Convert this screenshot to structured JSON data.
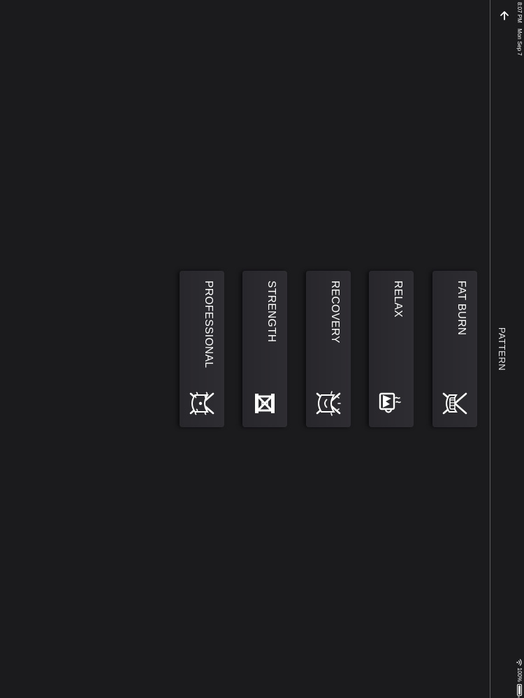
{
  "status_bar": {
    "time": "8:07 PM",
    "date": "Mon Sep 7",
    "battery": "100%",
    "battery_level": 1.0
  },
  "nav": {
    "title": "PATTERN",
    "back_icon": "arrow-left-icon"
  },
  "modes": [
    {
      "label": "FAT BURN",
      "icon": "fat-burn-icon"
    },
    {
      "label": "RELAX",
      "icon": "relax-icon"
    },
    {
      "label": "RECOVERY",
      "icon": "recovery-icon"
    },
    {
      "label": "STRENGTH",
      "icon": "strength-icon"
    },
    {
      "label": "PROFESSIONAL",
      "icon": "professional-icon"
    }
  ],
  "colors": {
    "background": "#1b1a1d",
    "card": "#2c2b2f",
    "text": "#ffffff",
    "divider": "#5c5b60"
  }
}
